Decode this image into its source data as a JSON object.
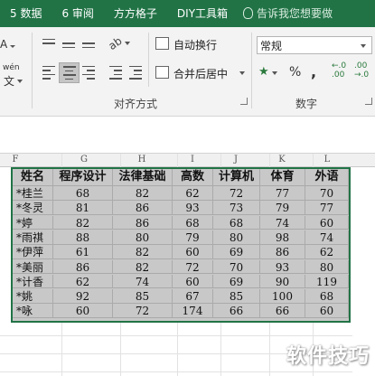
{
  "tabs": [
    "5 数据",
    "6 审阅",
    "方方格子",
    "DIY工具箱"
  ],
  "tell_me": "告诉我您想要做",
  "ribbon": {
    "wrap_text": "自动换行",
    "merge_center": "合并后居中",
    "align_group": "对齐方式",
    "number_format": "常规",
    "number_group": "数字",
    "percent": "%",
    "comma": ",",
    "inc_decimal": "←.0\n.00",
    "dec_decimal": ".00\n→.0",
    "font_small_a": "A",
    "wen": "wén",
    "wen_char": "文"
  },
  "columns": [
    "F",
    "G",
    "H",
    "I",
    "J",
    "K",
    "L"
  ],
  "table": {
    "headers": [
      "姓名",
      "程序设计",
      "法律基础",
      "高数",
      "计算机",
      "体育",
      "外语"
    ],
    "rows": [
      [
        "*桂兰",
        "68",
        "82",
        "62",
        "72",
        "77",
        "70"
      ],
      [
        "*冬灵",
        "81",
        "86",
        "93",
        "73",
        "79",
        "77"
      ],
      [
        "*婷",
        "82",
        "86",
        "68",
        "68",
        "74",
        "60"
      ],
      [
        "*雨祺",
        "88",
        "80",
        "79",
        "80",
        "98",
        "74"
      ],
      [
        "*伊萍",
        "61",
        "82",
        "60",
        "69",
        "86",
        "62"
      ],
      [
        "*美丽",
        "86",
        "82",
        "72",
        "70",
        "93",
        "80"
      ],
      [
        "*计香",
        "62",
        "74",
        "60",
        "69",
        "90",
        "119"
      ],
      [
        "*姚",
        "92",
        "85",
        "67",
        "85",
        "100",
        "68"
      ],
      [
        "*咏",
        "60",
        "72",
        "174",
        "66",
        "66",
        "60"
      ]
    ]
  },
  "watermark": "软件技巧",
  "colors": {
    "accent": "#217346",
    "selection": "#c8c8c8"
  }
}
